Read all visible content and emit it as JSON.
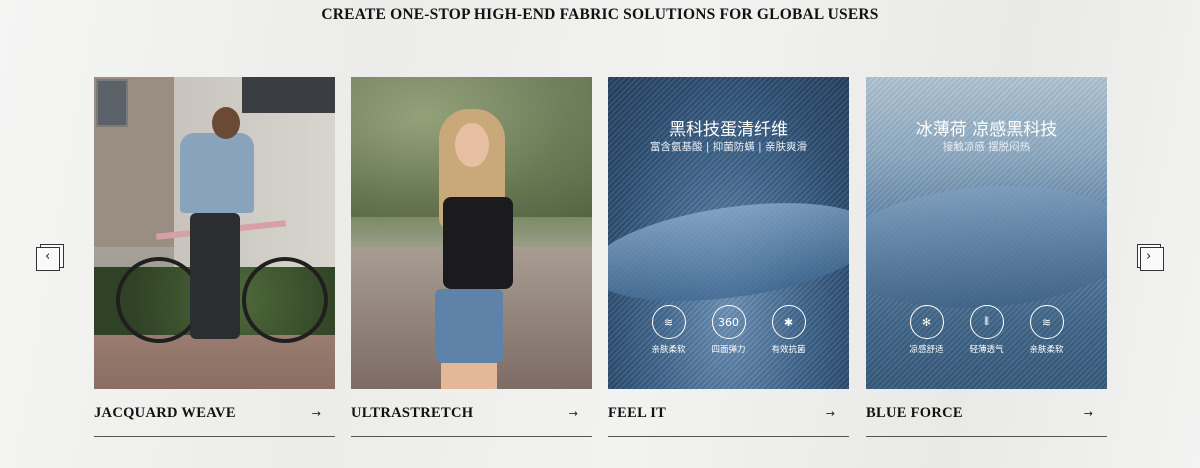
{
  "headline": "CREATE ONE-STOP HIGH-END FABRIC SOLUTIONS FOR GLOBAL USERS",
  "nav": {
    "prev_icon": "chevron-left-icon",
    "next_icon": "chevron-right-icon",
    "prev_glyph": "‹",
    "next_glyph": "›"
  },
  "cards": [
    {
      "label": "JACQUARD WEAVE",
      "arrow": "→"
    },
    {
      "label": "ULTRASTRETCH",
      "arrow": "→"
    },
    {
      "label": "FEEL IT",
      "arrow": "→",
      "overlay_title": "黑科技蛋清纤维",
      "overlay_subtitle": "富含氨基酸 | 抑菌防螨 | 亲肤爽滑",
      "badges": [
        {
          "icon": "wave-icon",
          "glyph": "≋",
          "label": "亲肤柔软"
        },
        {
          "icon": "stretch-360-icon",
          "glyph": "360",
          "label": "四面弹力"
        },
        {
          "icon": "anti-mite-icon",
          "glyph": "✱",
          "label": "有效抗菌"
        }
      ]
    },
    {
      "label": "BLUE FORCE",
      "arrow": "→",
      "overlay_title": "冰薄荷 凉感黑科技",
      "overlay_subtitle": "接触凉感 摆脱闷热",
      "badges": [
        {
          "icon": "mint-leaf-icon",
          "glyph": "✻",
          "label": "凉感舒适"
        },
        {
          "icon": "breathable-icon",
          "glyph": "⫴",
          "label": "轻薄透气"
        },
        {
          "icon": "wave-icon",
          "glyph": "≋",
          "label": "亲肤柔软"
        }
      ]
    }
  ],
  "colors": {
    "background": "#efefee",
    "text": "#111111",
    "denim_dark": "#2a4a6d",
    "denim_light": "#8ca8c0"
  }
}
